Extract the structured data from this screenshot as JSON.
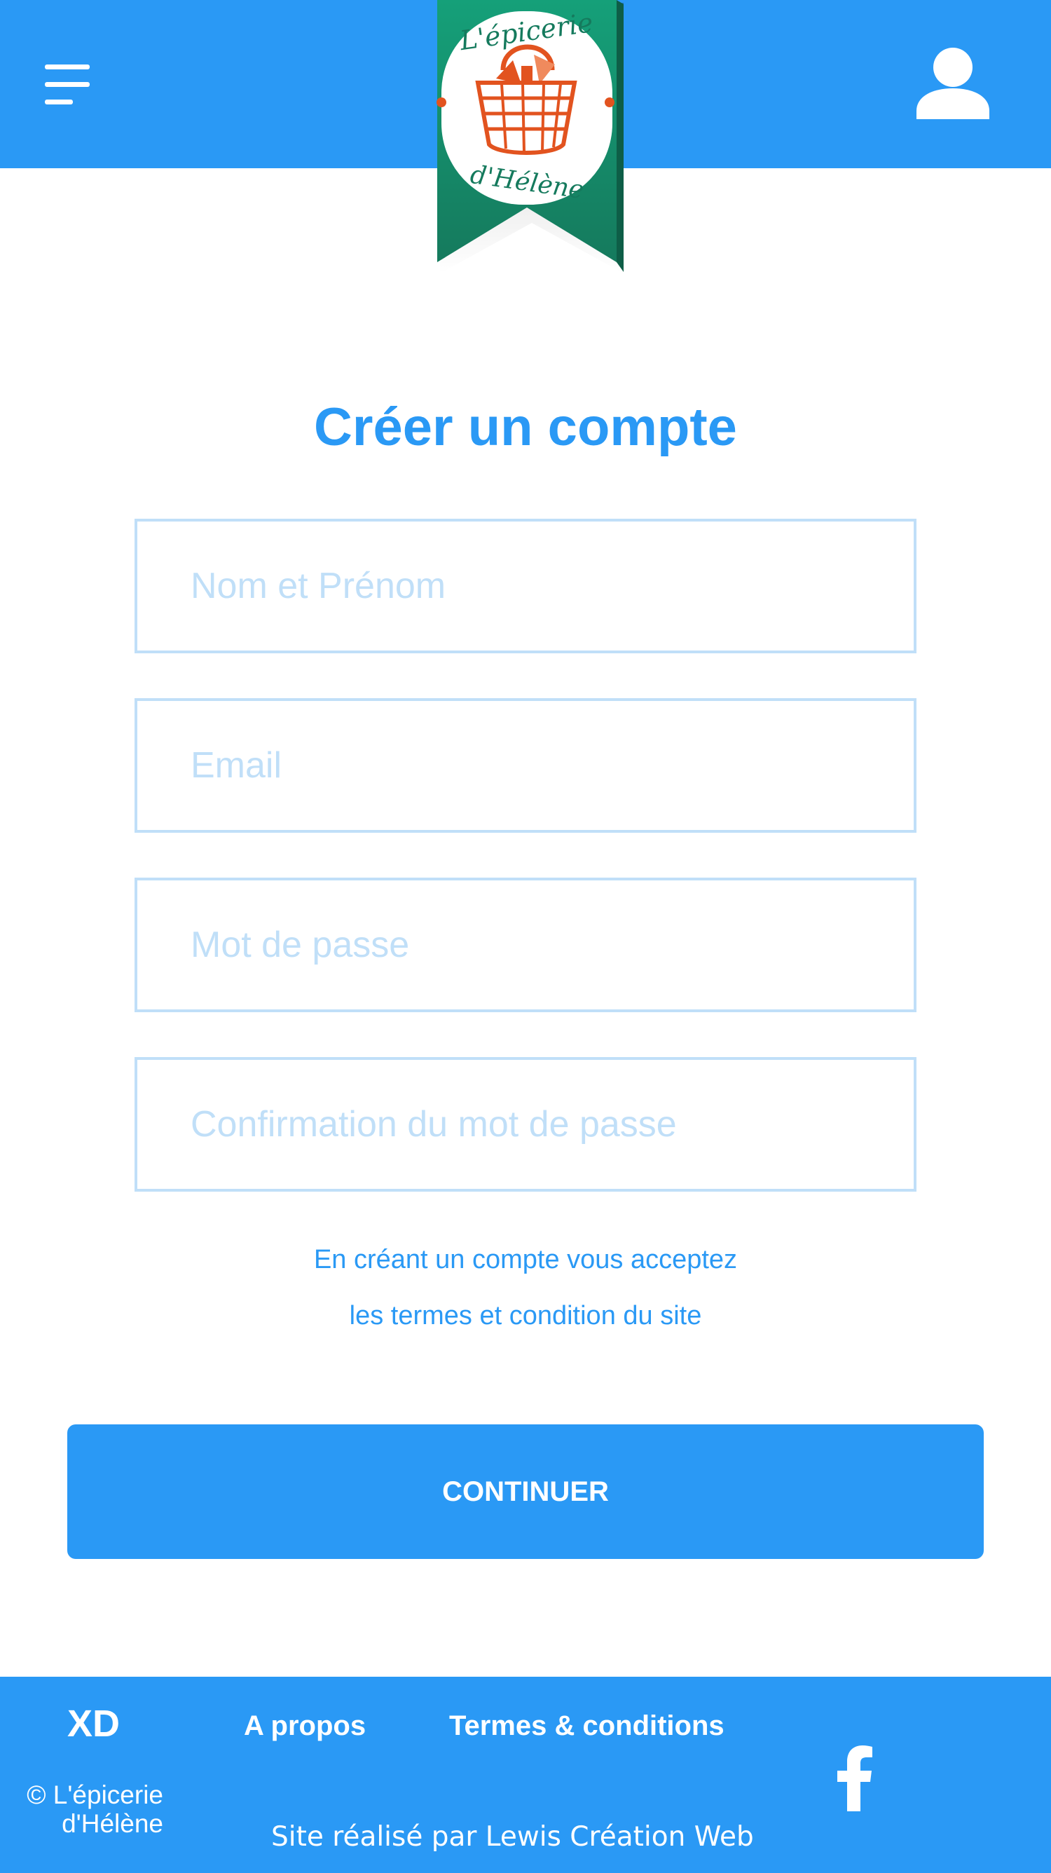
{
  "header": {
    "menu_icon": "menu-icon",
    "user_icon": "user-icon",
    "logo": {
      "line1": "L'épicerie",
      "line2": "d'Hélène",
      "image": "basket-icon"
    }
  },
  "form": {
    "title": "Créer un compte",
    "fields": [
      {
        "placeholder": "Nom et Prénom",
        "value": ""
      },
      {
        "placeholder": "Email",
        "value": ""
      },
      {
        "placeholder": "Mot de passe",
        "value": ""
      },
      {
        "placeholder": "Confirmation du mot de passe",
        "value": ""
      }
    ],
    "terms_line1": "En créant un compte vous acceptez",
    "terms_line2": "les termes et condition du site",
    "submit_label": "CONTINUER"
  },
  "footer": {
    "brand": "XD",
    "copyright_line1": "© L'épicerie",
    "copyright_line2": "d'Hélène",
    "links": [
      "A propos",
      "Termes & conditions"
    ],
    "credit": "Site réalisé par Lewis Création Web",
    "social_icon": "facebook-icon"
  },
  "colors": {
    "primary": "#2a99f5",
    "field_border": "#c0dff8",
    "logo_green": "#1b8a6b",
    "logo_orange": "#e2531f",
    "background": "#ffffff"
  }
}
